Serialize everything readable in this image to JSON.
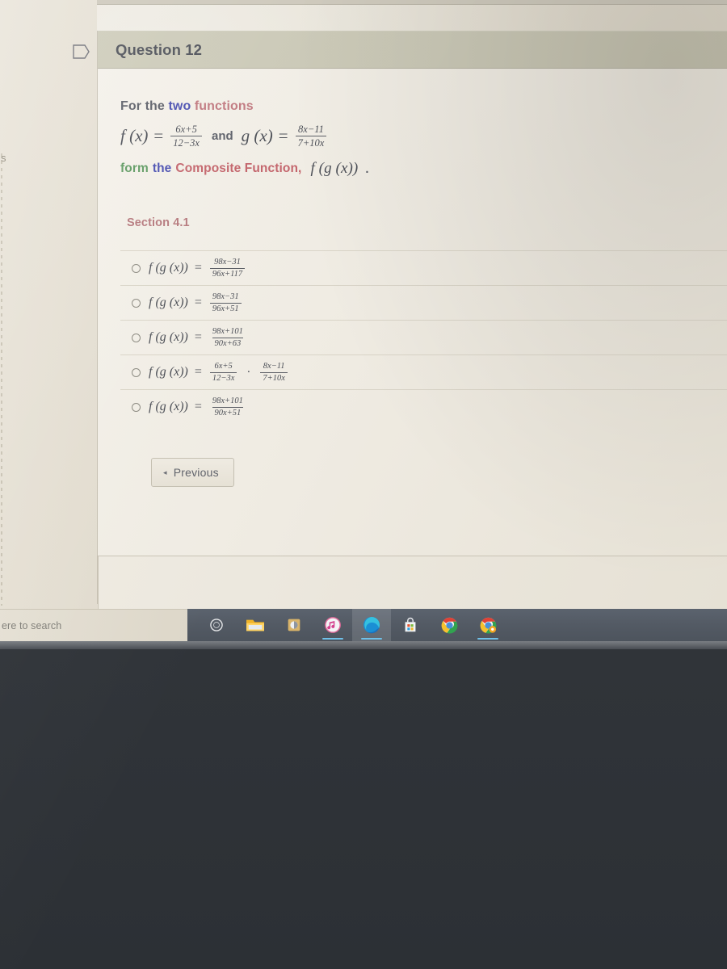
{
  "window": {
    "question_header": "Question 12"
  },
  "desktop": {
    "left_fragment": "s"
  },
  "prompt": {
    "line1": [
      {
        "text": "For the ",
        "color": "#5c5f68"
      },
      {
        "text": "two ",
        "color": "#4a4fb0"
      },
      {
        "text": "functions",
        "color": "#c0787f"
      }
    ],
    "line1_plain": "For the two functions",
    "f_label": "f (x)",
    "f_equals": "=",
    "f_numerator": "6x+5",
    "f_denominator": "12−3x",
    "and_word": "and",
    "g_label": "g (x)",
    "g_equals": "=",
    "g_numerator": "8x−11",
    "g_denominator": "7+10x",
    "line3_form": "form",
    "line3_the": "the",
    "line3_composite": "Composite Function,",
    "line3_expr": "f (g (x))",
    "line3_period": "."
  },
  "section": {
    "label": "Section 4.1"
  },
  "options": [
    {
      "id": "option-1",
      "expr_label": "f (g (x))",
      "equals": "=",
      "numerator": "98x−31",
      "denominator": "96x+117",
      "selected": false,
      "has_second_fraction": false
    },
    {
      "id": "option-2",
      "expr_label": "f (g (x))",
      "equals": "=",
      "numerator": "98x−31",
      "denominator": "96x+51",
      "selected": false,
      "has_second_fraction": false
    },
    {
      "id": "option-3",
      "expr_label": "f (g (x))",
      "equals": "=",
      "numerator": "98x+101",
      "denominator": "90x+63",
      "selected": false,
      "has_second_fraction": false
    },
    {
      "id": "option-4",
      "expr_label": "f (g (x))",
      "equals": "=",
      "numerator": "6x+5",
      "denominator": "12−3x",
      "operator": "·",
      "numerator2": "8x−11",
      "denominator2": "7+10x",
      "selected": false,
      "has_second_fraction": true
    },
    {
      "id": "option-5",
      "expr_label": "f (g (x))",
      "equals": "=",
      "numerator": "98x+101",
      "denominator": "90x+51",
      "selected": false,
      "has_second_fraction": false
    }
  ],
  "navigation": {
    "previous_label": "Previous",
    "previous_arrow": "◂"
  },
  "taskbar": {
    "search_placeholder": "ere to search",
    "items": [
      {
        "name": "cortana-icon",
        "label": "Cortana",
        "active": false,
        "running": false
      },
      {
        "name": "file-explorer-icon",
        "label": "File Explorer",
        "active": false,
        "running": false
      },
      {
        "name": "lastpass-icon",
        "label": "App",
        "active": false,
        "running": false
      },
      {
        "name": "itunes-icon",
        "label": "iTunes",
        "active": false,
        "running": true
      },
      {
        "name": "microsoft-edge-icon",
        "label": "Microsoft Edge",
        "active": true,
        "running": true
      },
      {
        "name": "microsoft-store-icon",
        "label": "Microsoft Store",
        "active": false,
        "running": false
      },
      {
        "name": "google-chrome-icon",
        "label": "Google Chrome",
        "active": false,
        "running": false
      },
      {
        "name": "google-chrome-beta-icon",
        "label": "Google Chrome Beta",
        "active": false,
        "running": true
      }
    ]
  },
  "colors": {
    "header_bg": "#c9c7b5",
    "card_bg": "#efebe2",
    "taskbar_bg": "#535a64",
    "accent_blue": "#4a4fb0",
    "accent_pink": "#c0787f",
    "accent_green": "#5f9a62",
    "section_red": "#b5787c",
    "taskbar_underline": "#6fc0e8"
  }
}
